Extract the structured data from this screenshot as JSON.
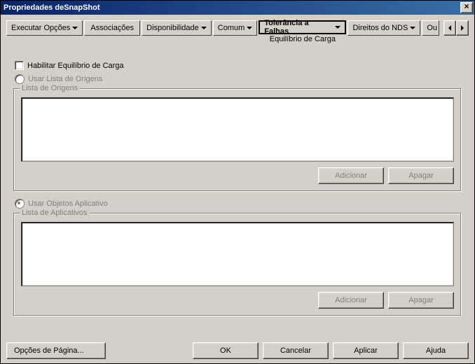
{
  "title": "Propriedades deSnapShot",
  "tabs": {
    "run_options": "Executar Opções",
    "associations": "Associações",
    "availability": "Disponibilidade",
    "common": "Comum",
    "fault_tolerance": "Tolerância a Falhas",
    "fault_tolerance_sub": "Equilíbrio de Carga",
    "nds_rights": "Direitos do NDS",
    "other": "Ou"
  },
  "checkbox": {
    "enable_lb": "Habilitar Equilíbrio de Carga"
  },
  "radios": {
    "use_source_list": "Usar Lista de Origens",
    "use_app_objects": "Usar Objetos Aplicativo"
  },
  "group_sources": {
    "title": "Lista de Origens",
    "add": "Adicionar",
    "delete": "Apagar"
  },
  "group_apps": {
    "title": "Lista de Aplicativos",
    "add": "Adicionar",
    "delete": "Apagar"
  },
  "buttons": {
    "page_options": "Opções de Página...",
    "ok": "OK",
    "cancel": "Cancelar",
    "apply": "Aplicar",
    "help": "Ajuda"
  }
}
